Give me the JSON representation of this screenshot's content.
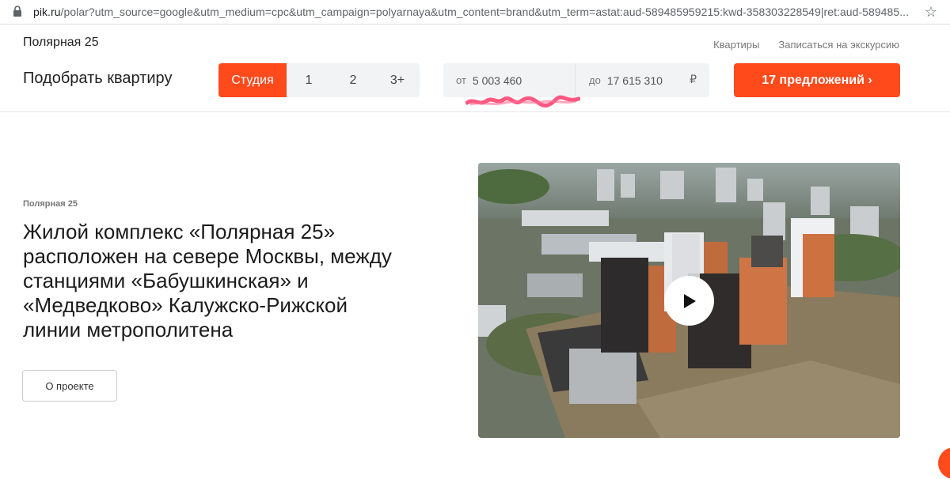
{
  "browser": {
    "url_host": "pik.ru",
    "url_rest": "/polar?utm_source=google&utm_medium=cpc&utm_campaign=polyarnaya&utm_content=brand&utm_term=astat:aud-589485959215:kwd-358303228549|ret:aud-589485...",
    "icons": {
      "lock": "lock-icon",
      "bookmark": "star-icon"
    }
  },
  "header": {
    "title": "Полярная 25",
    "nav": [
      "Квартиры",
      "Записаться на экскурсию"
    ]
  },
  "filter": {
    "title": "Подобрать квартиру",
    "rooms": [
      "Студия",
      "1",
      "2",
      "3+"
    ],
    "active_room": "Студия",
    "price_from_prefix": "от",
    "price_from": "5 003 460",
    "price_to_prefix": "до",
    "price_to": "17 615 310",
    "currency": "₽",
    "offers_button": "17 предложений ›"
  },
  "main": {
    "eyebrow": "Полярная 25",
    "headline": "Жилой комплекс «Полярная 25» расположен на севере Москвы, между станциями «Бабушкинская» и «Медведково» Калужско-Рижской линии метрополитена",
    "about_button": "О проекте",
    "video_icon": "play-icon"
  },
  "colors": {
    "accent": "#ff4a1c",
    "field_bg": "#f2f3f5"
  }
}
